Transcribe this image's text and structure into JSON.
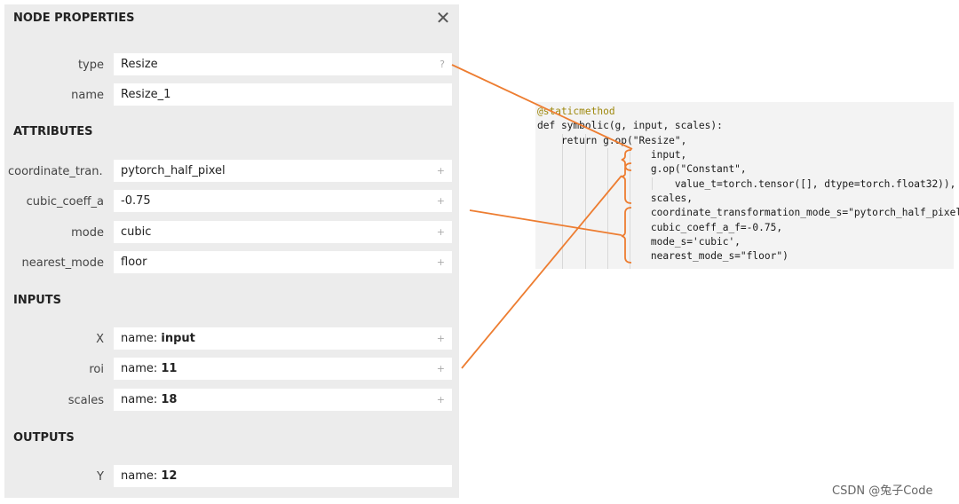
{
  "panel": {
    "title": "NODE PROPERTIES",
    "close_icon": "close-icon",
    "type_label": "type",
    "type_value": "Resize",
    "type_help": "?",
    "name_label": "name",
    "name_value": "Resize_1",
    "attributes_title": "ATTRIBUTES",
    "attributes": [
      {
        "label": "coordinate_tran...",
        "value": "pytorch_half_pixel"
      },
      {
        "label": "cubic_coeff_a",
        "value": "-0.75"
      },
      {
        "label": "mode",
        "value": "cubic"
      },
      {
        "label": "nearest_mode",
        "value": "floor"
      }
    ],
    "inputs_title": "INPUTS",
    "inputs": [
      {
        "label": "X",
        "prefix": "name: ",
        "value": "input"
      },
      {
        "label": "roi",
        "prefix": "name: ",
        "value": "11"
      },
      {
        "label": "scales",
        "prefix": "name: ",
        "value": "18"
      }
    ],
    "outputs_title": "OUTPUTS",
    "outputs": [
      {
        "label": "Y",
        "prefix": "name: ",
        "value": "12"
      }
    ],
    "expand_symbol": "+"
  },
  "code": {
    "lines": [
      "@staticmethod",
      "def symbolic(g, input, scales):",
      "    return g.op(\"Resize\",",
      "        input,",
      "        g.op(\"Constant\",",
      "            value_t=torch.tensor([], dtype=torch.float32)),",
      "        scales,",
      "        coordinate_transformation_mode_s=\"pytorch_half_pixel\",",
      "        cubic_coeff_a_f=-0.75,",
      "        mode_s='cubic',",
      "        nearest_mode_s=\"floor\")"
    ]
  },
  "annotation_color": "#ed7d31",
  "watermark": "CSDN @兔子Code"
}
